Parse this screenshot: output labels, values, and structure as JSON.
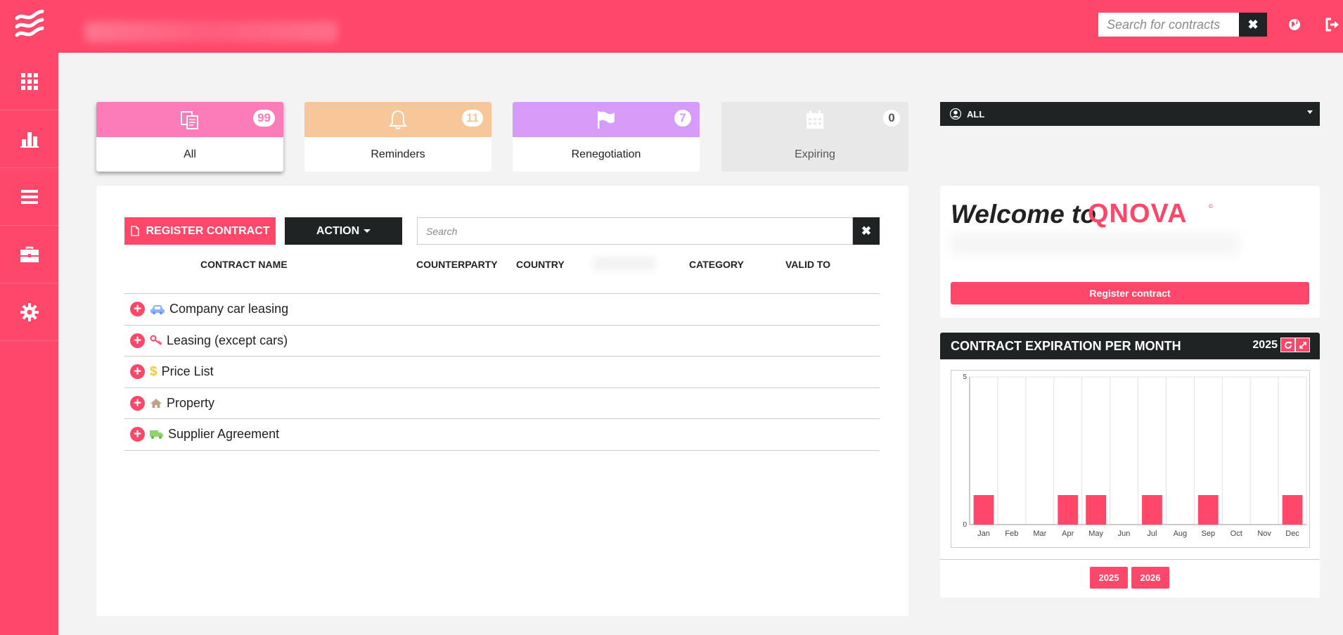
{
  "header": {
    "search_placeholder": "Search for contracts",
    "clear_label": "✖",
    "brand_color": "#ff4769"
  },
  "sidebar": {
    "items": [
      {
        "icon": "grid-icon"
      },
      {
        "icon": "bar-chart-icon"
      },
      {
        "icon": "list-icon"
      },
      {
        "icon": "briefcase-icon"
      },
      {
        "icon": "gear-icon"
      }
    ]
  },
  "tiles": [
    {
      "label": "All",
      "count": "99",
      "color": "#fb7cb8",
      "icon": "documents-icon",
      "selected": true
    },
    {
      "label": "Reminders",
      "count": "11",
      "color": "#f7c79a",
      "icon": "bell-icon"
    },
    {
      "label": "Renegotiation",
      "count": "7",
      "color": "#d79cf7",
      "icon": "flag-icon"
    },
    {
      "label": "Expiring",
      "count": "0",
      "color": "#e8e8e8",
      "icon": "calendar-icon"
    }
  ],
  "user_select": {
    "value": "ALL"
  },
  "toolbar": {
    "register_label": "REGISTER CONTRACT",
    "action_label": "ACTION",
    "search_placeholder": "Search",
    "clear_label": "✖"
  },
  "columns": {
    "name": "CONTRACT NAME",
    "counterparty": "COUNTERPARTY",
    "country": "COUNTRY",
    "category": "CATEGORY",
    "valid_to": "VALID TO"
  },
  "categories": [
    {
      "label": "Company car leasing",
      "icon": "car-icon",
      "icon_color": "#8fb3ff"
    },
    {
      "label": "Leasing (except cars)",
      "icon": "key-icon",
      "icon_color": "#ff4769"
    },
    {
      "label": "Price List",
      "icon": "dollar-icon",
      "icon_color": "#f2c94c"
    },
    {
      "label": "Property",
      "icon": "home-icon",
      "icon_color": "#b9a38a"
    },
    {
      "label": "Supplier Agreement",
      "icon": "truck-icon",
      "icon_color": "#8fd46b"
    }
  ],
  "welcome": {
    "title": "Welcome to",
    "brand": "QNOVA",
    "register_label": "Register contract"
  },
  "chart_panel": {
    "title": "CONTRACT EXPIRATION PER MONTH",
    "year": "2025",
    "year_buttons": [
      "2025",
      "2026"
    ]
  },
  "chart_data": {
    "type": "bar",
    "categories": [
      "Jan",
      "Feb",
      "Mar",
      "Apr",
      "May",
      "Jun",
      "Jul",
      "Aug",
      "Sep",
      "Oct",
      "Nov",
      "Dec"
    ],
    "values": [
      1,
      0,
      0,
      1,
      1,
      0,
      1,
      0,
      1,
      0,
      0,
      1
    ],
    "y_ticks": [
      "0",
      "5"
    ],
    "ylim": [
      0,
      5
    ],
    "color": "#ff4769",
    "grid": true
  }
}
